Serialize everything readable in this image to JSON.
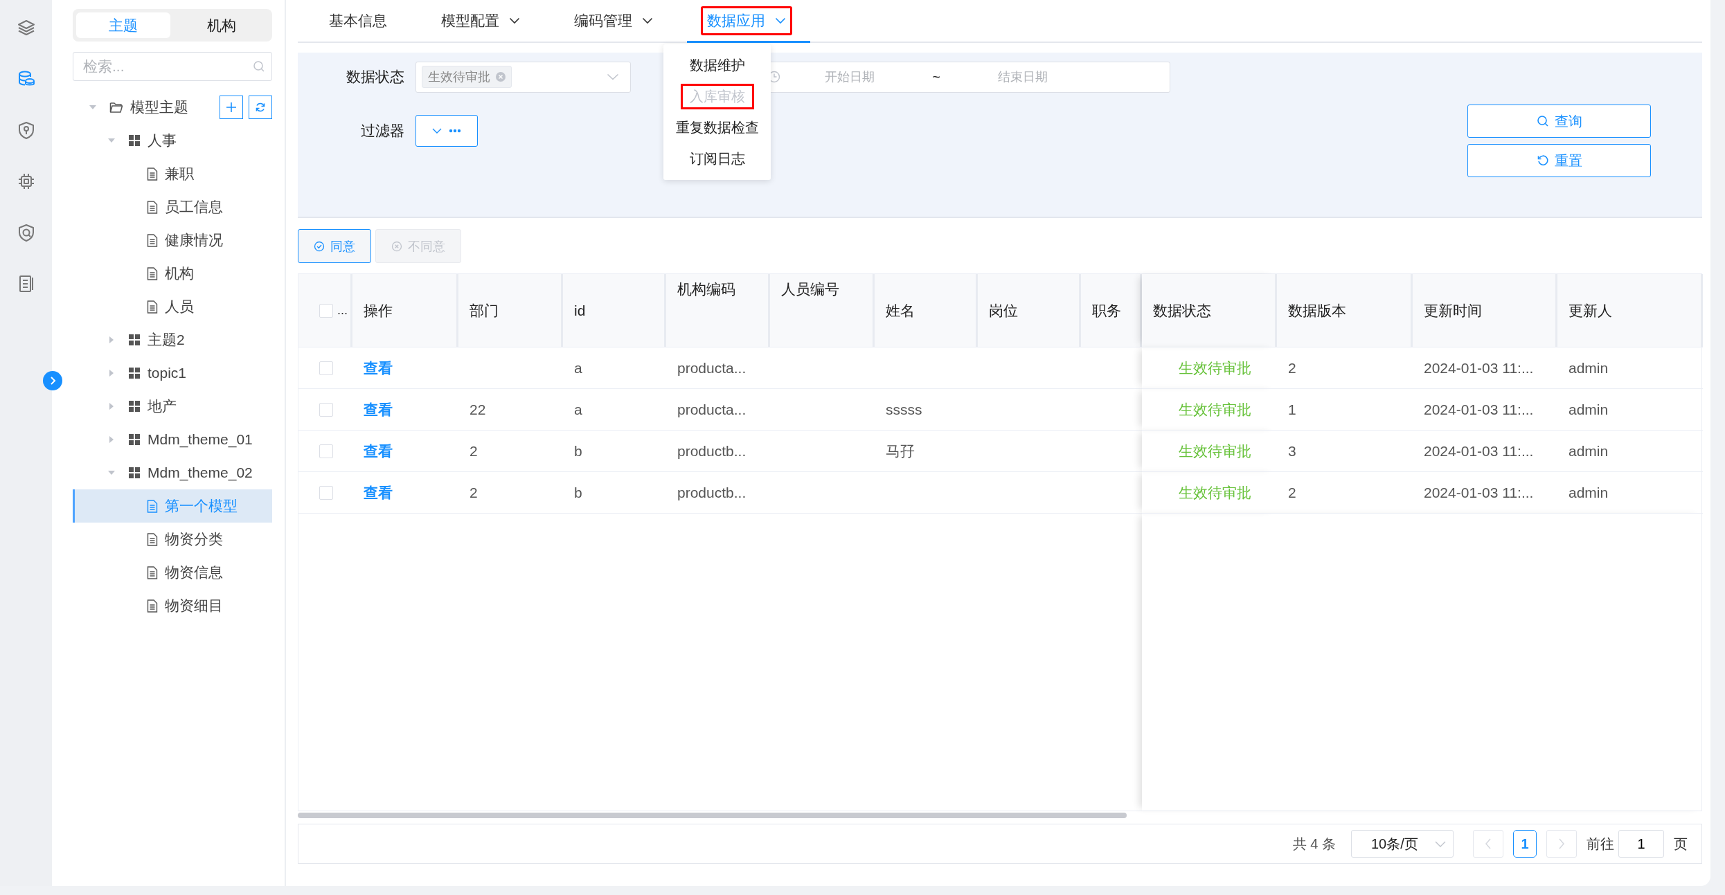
{
  "rail": [
    {
      "selected": false
    },
    {
      "selected": true
    },
    {
      "selected": false
    },
    {
      "selected": false
    },
    {
      "selected": false
    },
    {
      "selected": false
    }
  ],
  "tree_tabs": [
    {
      "label": "主题",
      "selected": true
    },
    {
      "label": "机构",
      "selected": false
    }
  ],
  "tree_search": {
    "placeholder": "检索..."
  },
  "tree": [
    {
      "label": "模型主题",
      "kind": "folder",
      "expanded": true,
      "selected": false,
      "children": [
        {
          "label": "人事",
          "kind": "group",
          "expanded": true,
          "selected": false,
          "children": [
            {
              "label": "兼职",
              "kind": "model",
              "selected": false
            },
            {
              "label": "员工信息",
              "kind": "model",
              "selected": false
            },
            {
              "label": "健康情况",
              "kind": "model",
              "selected": false
            },
            {
              "label": "机构",
              "kind": "model",
              "selected": false
            },
            {
              "label": "人员",
              "kind": "model",
              "selected": false
            }
          ]
        },
        {
          "label": "主题2",
          "kind": "group",
          "expanded": false,
          "selected": false
        },
        {
          "label": "topic1",
          "kind": "group",
          "expanded": false,
          "selected": false
        },
        {
          "label": "地产",
          "kind": "group",
          "expanded": false,
          "selected": false
        },
        {
          "label": "Mdm_theme_01",
          "kind": "group",
          "expanded": false,
          "selected": false
        },
        {
          "label": "Mdm_theme_02",
          "kind": "group",
          "expanded": true,
          "selected": false,
          "children": [
            {
              "label": "第一个模型",
              "kind": "model",
              "selected": true
            },
            {
              "label": "物资分类",
              "kind": "model",
              "selected": false
            },
            {
              "label": "物资信息",
              "kind": "model",
              "selected": false
            },
            {
              "label": "物资细目",
              "kind": "model",
              "selected": false
            }
          ]
        }
      ]
    }
  ],
  "nav_tabs": [
    {
      "label": "基本信息",
      "selected": false,
      "has_menu": false,
      "highlighted": false
    },
    {
      "label": "模型配置",
      "selected": false,
      "has_menu": true,
      "highlighted": false
    },
    {
      "label": "编码管理",
      "selected": false,
      "has_menu": true,
      "highlighted": false
    },
    {
      "label": "数据应用",
      "selected": true,
      "has_menu": true,
      "highlighted": true
    }
  ],
  "menu": {
    "items": [
      {
        "label": "数据维护",
        "disabled": false,
        "highlighted": false
      },
      {
        "label": "入库审核",
        "disabled": true,
        "highlighted": true
      },
      {
        "label": "重复数据检查",
        "disabled": false,
        "highlighted": false
      },
      {
        "label": "订阅日志",
        "disabled": false,
        "highlighted": false
      }
    ]
  },
  "filters": {
    "status": {
      "label": "数据状态",
      "tags": [
        "生效待审批"
      ]
    },
    "date_range": {
      "start_placeholder": "开始日期",
      "separator": "~",
      "end_placeholder": "结束日期"
    },
    "filter": {
      "label": "过滤器"
    },
    "buttons": [
      {
        "label": "查询",
        "kind": "search"
      },
      {
        "label": "重置",
        "kind": "reset"
      }
    ]
  },
  "actions": [
    {
      "label": "同意",
      "kind": "approve",
      "disabled": false
    },
    {
      "label": "不同意",
      "kind": "reject",
      "disabled": true
    }
  ],
  "table": {
    "select_label": "...",
    "select_all": false,
    "columns": [
      {
        "label": "操作",
        "kind": "link"
      },
      {
        "label": "部门",
        "kind": "text"
      },
      {
        "label": "id",
        "kind": "text"
      },
      {
        "label": "机构编码",
        "kind": "text"
      },
      {
        "label": "人员编号",
        "kind": "text"
      },
      {
        "label": "姓名",
        "kind": "text"
      },
      {
        "label": "岗位",
        "kind": "text"
      },
      {
        "label": "职务",
        "kind": "text"
      },
      {
        "label": "数据状态",
        "kind": "status"
      },
      {
        "label": "数据版本",
        "kind": "text"
      },
      {
        "label": "更新时间",
        "kind": "text"
      },
      {
        "label": "更新人",
        "kind": "text"
      }
    ],
    "rows": [
      {
        "checked": false,
        "cells": [
          "查看",
          "",
          "a",
          "producta...",
          "",
          "",
          "",
          "",
          "生效待审批",
          "2",
          "2024-01-03 11:...",
          "admin"
        ]
      },
      {
        "checked": false,
        "cells": [
          "查看",
          "22",
          "a",
          "producta...",
          "",
          "sssss",
          "",
          "",
          "生效待审批",
          "1",
          "2024-01-03 11:...",
          "admin"
        ]
      },
      {
        "checked": false,
        "cells": [
          "查看",
          "2",
          "b",
          "productb...",
          "",
          "马孖",
          "",
          "",
          "生效待审批",
          "3",
          "2024-01-03 11:...",
          "admin"
        ]
      },
      {
        "checked": false,
        "cells": [
          "查看",
          "2",
          "b",
          "productb...",
          "",
          "",
          "",
          "",
          "生效待审批",
          "2",
          "2024-01-03 11:...",
          "admin"
        ]
      }
    ]
  },
  "pagination": {
    "total": "共 4 条",
    "page_size": "10条/页",
    "prev_disabled": true,
    "next_disabled": true,
    "pages": [
      {
        "label": "1",
        "selected": true
      }
    ],
    "goto_label": "前往",
    "goto_value": "1",
    "page_suffix": "页"
  }
}
